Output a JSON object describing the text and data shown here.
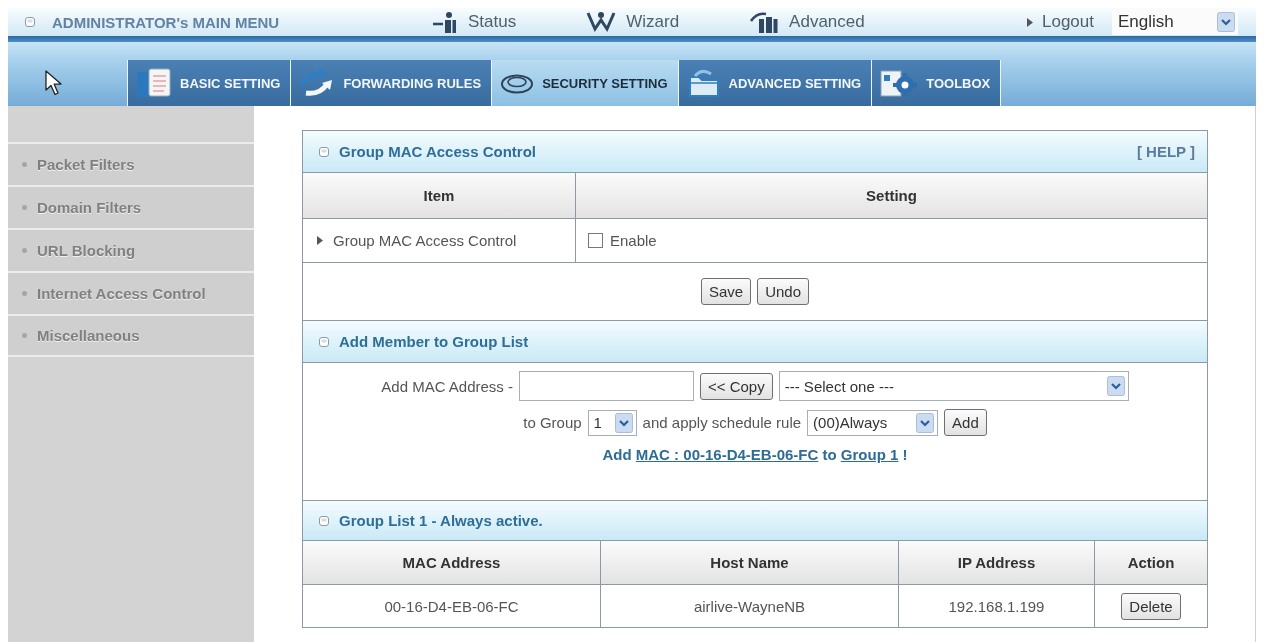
{
  "top_menu": {
    "title": "ADMINISTRATOR's MAIN MENU",
    "links": [
      {
        "kind": "status",
        "label": "Status"
      },
      {
        "kind": "wizard",
        "label": "Wizard"
      },
      {
        "kind": "advanced",
        "label": "Advanced"
      }
    ],
    "logout": "Logout",
    "language": "English"
  },
  "nav_tabs": [
    {
      "kind": "basic",
      "label": "BASIC SETTING",
      "selected": false
    },
    {
      "kind": "forwarding",
      "label": "FORWARDING RULES",
      "selected": false
    },
    {
      "kind": "security",
      "label": "SECURITY SETTING",
      "selected": true
    },
    {
      "kind": "advanced",
      "label": "ADVANCED SETTING",
      "selected": false
    },
    {
      "kind": "toolbox",
      "label": "TOOLBOX",
      "selected": false
    }
  ],
  "sidebar": {
    "items": [
      {
        "label": "Packet Filters"
      },
      {
        "label": "Domain Filters"
      },
      {
        "label": "URL Blocking"
      },
      {
        "label": "Internet Access Control"
      },
      {
        "label": "Miscellaneous"
      }
    ]
  },
  "mac_control": {
    "title": "Group MAC Access Control",
    "help": "[ HELP ]",
    "columns": [
      "Item",
      "Setting"
    ],
    "rows": [
      {
        "item": "Group MAC Access Control",
        "option": "Enable",
        "checked": false
      }
    ],
    "buttons": [
      "Save",
      "Undo"
    ]
  },
  "add_member": {
    "title": "Add Member to Group List",
    "mac_label": "Add MAC Address -",
    "copy_button": "<< Copy",
    "host_select": "--- Select one ---",
    "group_label": "to Group",
    "group_select": "1",
    "schedule_label": "and apply schedule rule",
    "schedule_select": "(00)Always",
    "add_button": "Add",
    "message": [
      {
        "kind": "text",
        "text": "Add"
      },
      {
        "kind": "link",
        "text": "MAC : 00-16-D4-EB-06-FC"
      },
      {
        "kind": "text",
        "text": "to"
      },
      {
        "kind": "link",
        "text": "Group 1"
      },
      {
        "kind": "text",
        "text": "!"
      }
    ]
  },
  "group_list": {
    "title": "Group List 1 - Always active.",
    "columns": [
      "MAC Address",
      "Host Name",
      "IP Address",
      "Action"
    ],
    "rows": [
      {
        "mac": "00-16-D4-EB-06-FC",
        "host": "airlive-WayneNB",
        "ip": "192.168.1.199",
        "action": "Delete"
      }
    ]
  }
}
